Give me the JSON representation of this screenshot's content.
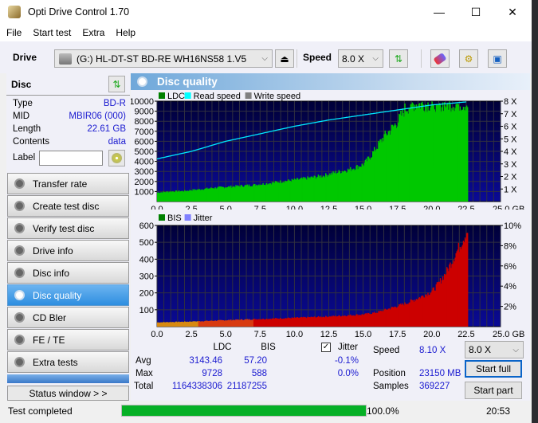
{
  "window": {
    "title": "Opti Drive Control 1.70",
    "minimize": "—",
    "maximize": "☐",
    "close": "✕"
  },
  "menu": [
    "File",
    "Start test",
    "Extra",
    "Help"
  ],
  "toolbar": {
    "drive_label": "Drive",
    "drive_value": "(G:)  HL-DT-ST BD-RE  WH16NS58 1.V5",
    "speed_label": "Speed",
    "speed_value": "8.0 X"
  },
  "disc": {
    "header": "Disc",
    "type_label": "Type",
    "type_value": "BD-R",
    "mid_label": "MID",
    "mid_value": "MBIR06 (000)",
    "length_label": "Length",
    "length_value": "22.61 GB",
    "contents_label": "Contents",
    "contents_value": "data",
    "label_label": "Label",
    "label_value": ""
  },
  "nav": [
    "Transfer rate",
    "Create test disc",
    "Verify test disc",
    "Drive info",
    "Disc info",
    "Disc quality",
    "CD Bler",
    "FE / TE",
    "Extra tests"
  ],
  "nav_active": "Disc quality",
  "status_window": "Status window > >",
  "panel_title": "Disc quality",
  "chart_data": [
    {
      "type": "area",
      "title": "LDC / Read speed",
      "legend": [
        "LDC",
        "Read speed",
        "Write speed"
      ],
      "legend_colors": [
        "#008000",
        "#00ffff",
        "#808080"
      ],
      "x_ticks": [
        "0.0",
        "2.5",
        "5.0",
        "7.5",
        "10.0",
        "12.5",
        "15.0",
        "17.5",
        "20.0",
        "22.5",
        "25.0 GB"
      ],
      "xlim": [
        0,
        25
      ],
      "y_ticks": [
        "1000",
        "2000",
        "3000",
        "4000",
        "5000",
        "6000",
        "7000",
        "8000",
        "9000",
        "10000"
      ],
      "ylim": [
        0,
        10000
      ],
      "y2_ticks": [
        "1 X",
        "2 X",
        "3 X",
        "4 X",
        "5 X",
        "6 X",
        "7 X",
        "8 X"
      ],
      "y2lim": [
        0,
        8
      ],
      "series": [
        {
          "name": "LDC",
          "x": [
            0,
            1,
            2,
            2.5,
            3,
            4,
            5,
            6,
            7,
            8,
            9,
            10,
            11,
            12,
            13,
            14,
            15,
            15.5,
            16,
            16.5,
            17,
            17.5,
            18,
            18.5,
            22.6
          ],
          "values": [
            900,
            1000,
            1050,
            1150,
            1200,
            1350,
            1450,
            1550,
            1650,
            1800,
            2000,
            2150,
            2350,
            2550,
            2900,
            3200,
            3700,
            4500,
            5500,
            6500,
            7200,
            8000,
            9200,
            9700,
            9700
          ]
        },
        {
          "name": "Read speed",
          "x": [
            0,
            2.5,
            5,
            7.5,
            10,
            12.5,
            15,
            17.5,
            20,
            22.6
          ],
          "values": [
            3.4,
            4.0,
            4.8,
            5.4,
            6.0,
            6.5,
            6.9,
            7.3,
            7.7,
            7.95
          ]
        }
      ],
      "grid": true
    },
    {
      "type": "area",
      "title": "BIS / Jitter",
      "legend": [
        "BIS",
        "Jitter"
      ],
      "legend_colors": [
        "#008000",
        "#8080ff"
      ],
      "x_ticks": [
        "0.0",
        "2.5",
        "5.0",
        "7.5",
        "10.0",
        "12.5",
        "15.0",
        "17.5",
        "20.0",
        "22.5",
        "25.0 GB"
      ],
      "xlim": [
        0,
        25
      ],
      "y_ticks": [
        "100",
        "200",
        "300",
        "400",
        "500",
        "600"
      ],
      "ylim": [
        0,
        600
      ],
      "y2_ticks": [
        "2%",
        "4%",
        "6%",
        "8%",
        "10%"
      ],
      "y2lim": [
        0,
        10
      ],
      "series": [
        {
          "name": "BIS",
          "x": [
            0,
            2.5,
            5,
            7.5,
            10,
            12.5,
            15,
            16,
            17,
            18,
            19,
            20,
            20.5,
            21,
            21.5,
            22,
            22.6
          ],
          "values": [
            25,
            30,
            38,
            45,
            52,
            60,
            72,
            85,
            110,
            135,
            170,
            210,
            260,
            320,
            400,
            480,
            580
          ]
        }
      ],
      "grid": true
    }
  ],
  "stats": {
    "col_ldc": "LDC",
    "col_bis": "BIS",
    "jitter_label": "Jitter",
    "jitter_checked": true,
    "avg_label": "Avg",
    "avg_ldc": "3143.46",
    "avg_bis": "57.20",
    "avg_jitter": "-0.1%",
    "max_label": "Max",
    "max_ldc": "9728",
    "max_bis": "588",
    "max_jitter": "0.0%",
    "total_label": "Total",
    "total_ldc": "1164338306",
    "total_bis": "21187255",
    "speed_label": "Speed",
    "speed_value": "8.10 X",
    "position_label": "Position",
    "position_value": "23150 MB",
    "samples_label": "Samples",
    "samples_value": "369227",
    "speed_select": "8.0 X",
    "start_full": "Start full",
    "start_part": "Start part"
  },
  "statusbar": {
    "text": "Test completed",
    "progress": 100,
    "progress_text": "100.0%",
    "time": "20:53"
  }
}
